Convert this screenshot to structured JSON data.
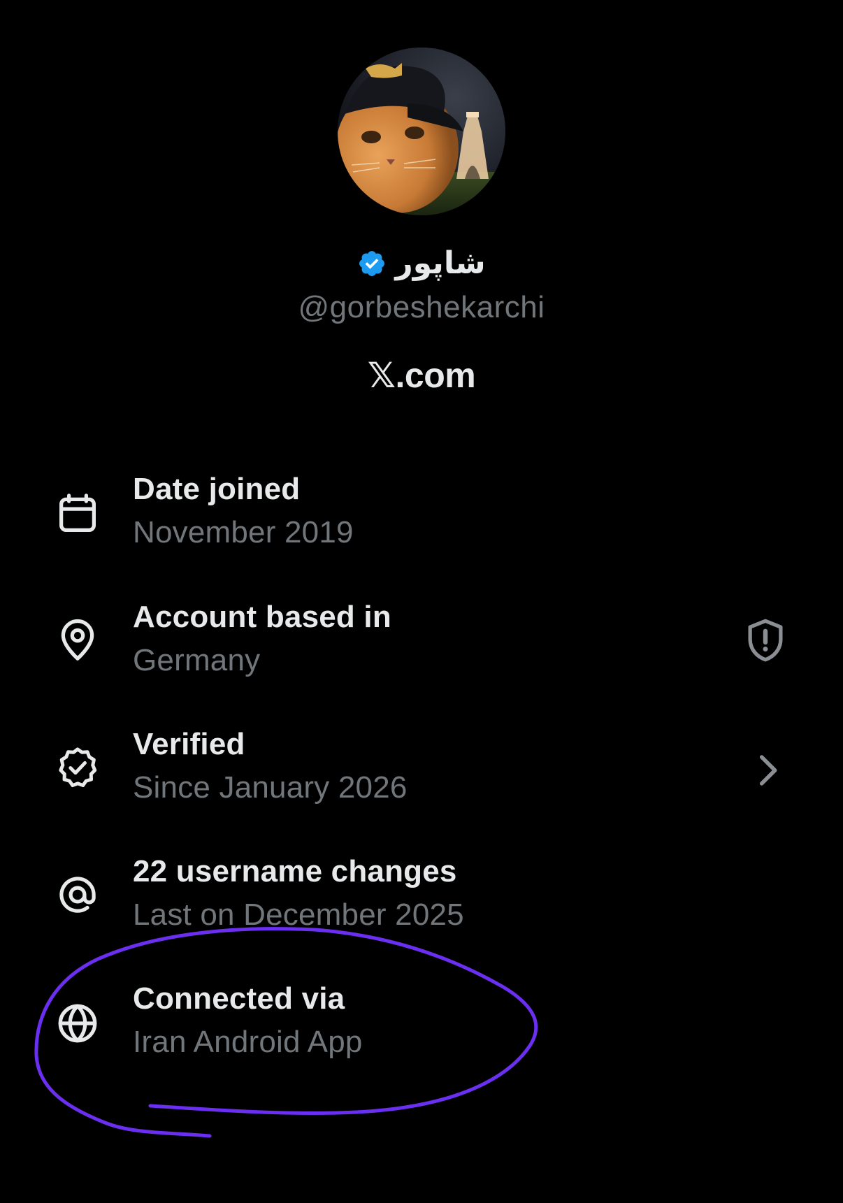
{
  "profile": {
    "display_name": "شاپور",
    "handle": "@gorbeshekarchi",
    "site": "𝕏.com",
    "verified_color": "#1d9bf0"
  },
  "info_rows": [
    {
      "icon": "calendar-icon",
      "title": "Date joined",
      "subtitle": "November 2019"
    },
    {
      "icon": "location-pin-icon",
      "title": "Account based in",
      "subtitle": "Germany",
      "trailing_icon": "shield-alert-icon"
    },
    {
      "icon": "verified-badge-icon",
      "title": "Verified",
      "subtitle": "Since January 2026",
      "trailing_icon": "chevron-right-icon"
    },
    {
      "icon": "at-sign-icon",
      "title": "22 username changes",
      "subtitle": "Last on December 2025"
    },
    {
      "icon": "globe-icon",
      "title": "Connected via",
      "subtitle": "Iran Android App"
    }
  ],
  "colors": {
    "background": "#000000",
    "primary_text": "#e7e9ea",
    "secondary_text": "#71767b",
    "annotation": "#6a2ff0"
  }
}
